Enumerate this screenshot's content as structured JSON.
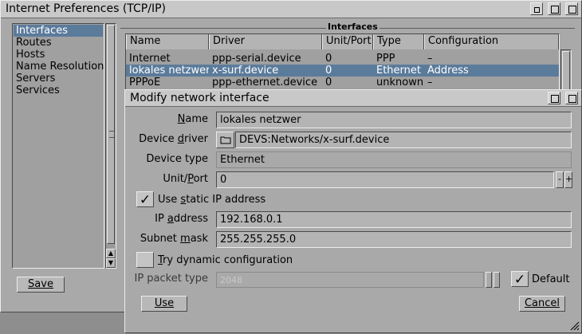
{
  "main_window": {
    "title": "Internet Preferences (TCP/IP)",
    "categories": [
      "Interfaces",
      "Routes",
      "Hosts",
      "Name Resolution",
      "Servers",
      "Services"
    ],
    "selected_category_index": 0,
    "save_label": "Save",
    "interfaces_group_label": "Interfaces",
    "table": {
      "columns": [
        "Name",
        "Driver",
        "Unit/Port",
        "Type",
        "Configuration"
      ],
      "rows": [
        {
          "name": "Internet",
          "driver": "ppp-serial.device",
          "unit": "0",
          "type": "PPP",
          "config": "–"
        },
        {
          "name": "lokales netzwer",
          "driver": "x-surf.device",
          "unit": "0",
          "type": "Ethernet",
          "config": "Address"
        },
        {
          "name": "PPPoE",
          "driver": "ppp-ethernet.device",
          "unit": "0",
          "type": "unknown",
          "config": "–"
        }
      ],
      "selected_row_index": 1
    }
  },
  "dialog": {
    "title": "Modify network interface",
    "name_label": "Name",
    "name_value": "lokales netzwer",
    "driver_label": "Device driver",
    "driver_value": "DEVS:Networks/x-surf.device",
    "type_label": "Device type",
    "type_value": "Ethernet",
    "unit_label": "Unit/Port",
    "unit_value": "0",
    "stepper_minus": "-",
    "stepper_plus": "+",
    "static_ip_label": "Use static IP address",
    "static_ip_checked": true,
    "ip_label": "IP address",
    "ip_value": "192.168.0.1",
    "mask_label": "Subnet mask",
    "mask_value": "255.255.255.0",
    "dynamic_label": "Try dynamic configuration",
    "dynamic_checked": false,
    "packet_label": "IP packet type",
    "packet_value": "2048",
    "default_label": "Default",
    "default_checked": true,
    "use_label": "Use",
    "cancel_label": "Cancel"
  },
  "colors": {
    "selection": "#5b7b9b",
    "window_bg": "#a9a9a9"
  }
}
